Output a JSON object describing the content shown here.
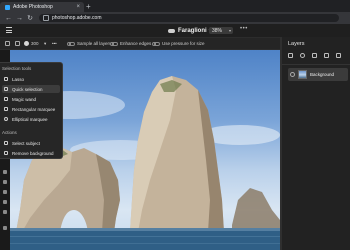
{
  "browser": {
    "tab_title": "Adobe Photoshop",
    "new_tab_glyph": "+",
    "close_glyph": "×",
    "url": "photoshop.adobe.com",
    "back_glyph": "←",
    "forward_glyph": "→",
    "reload_glyph": "↻"
  },
  "app": {
    "document_title": "Faraglioni",
    "zoom": "38%",
    "more_glyph": "•••"
  },
  "options": {
    "size_value": "300",
    "sample_all_layers": "Sample all layers",
    "enhance_edges": "Enhance edges",
    "use_pressure": "Use pressure for size"
  },
  "flyout": {
    "section_selection": "Selection tools",
    "items": [
      {
        "label": "Lasso",
        "icon": "lasso-icon"
      },
      {
        "label": "Quick selection",
        "icon": "quick-selection-icon"
      },
      {
        "label": "Magic wand",
        "icon": "magic-wand-icon"
      },
      {
        "label": "Rectangular marquee",
        "icon": "rect-marquee-icon"
      },
      {
        "label": "Elliptical marquee",
        "icon": "ellipse-marquee-icon"
      }
    ],
    "section_actions": "Actions",
    "actions": [
      {
        "label": "Select subject",
        "icon": "select-subject-icon"
      },
      {
        "label": "Remove background",
        "icon": "remove-background-icon"
      }
    ]
  },
  "layers": {
    "title": "Layers",
    "items": [
      {
        "name": "Background",
        "selected": true
      }
    ]
  },
  "colors": {
    "accent": "#31a8ff",
    "panel": "#222222",
    "sea": "#2f5f86"
  }
}
